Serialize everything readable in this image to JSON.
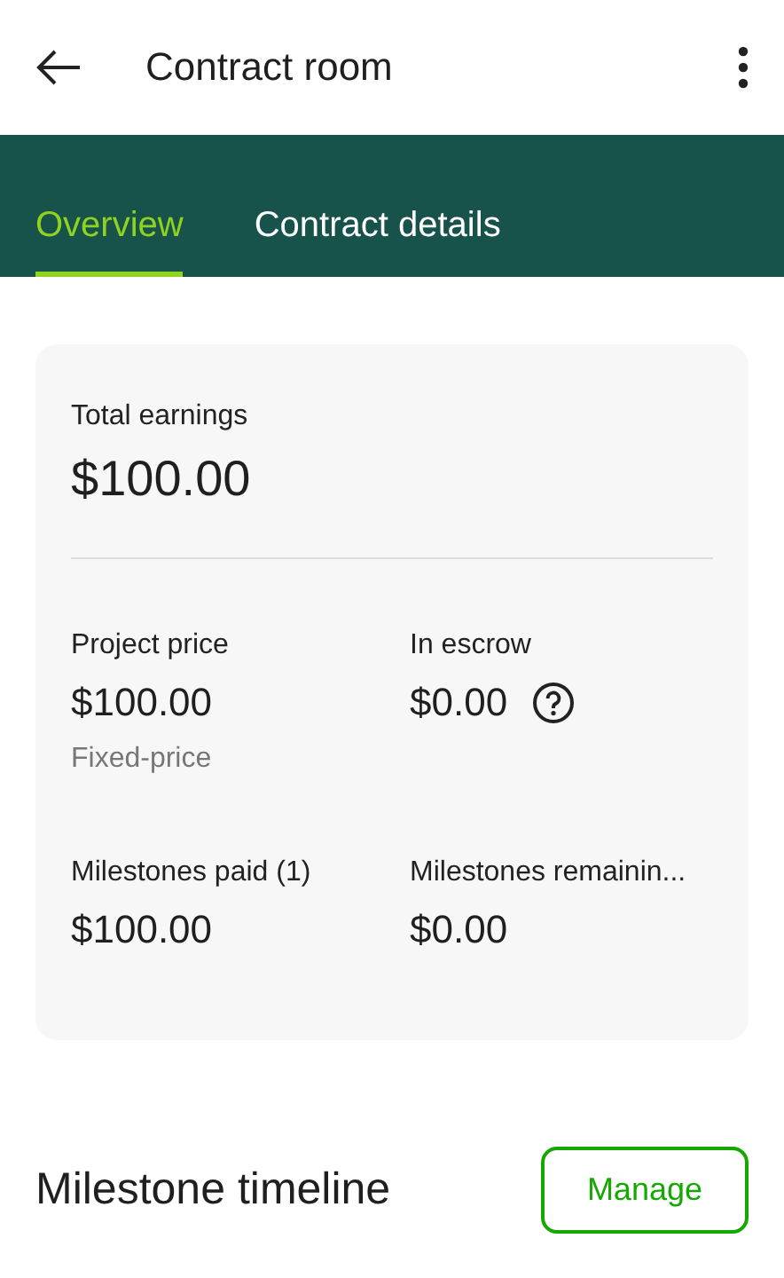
{
  "header": {
    "title": "Contract room"
  },
  "tabs": [
    {
      "label": "Overview",
      "selected": true
    },
    {
      "label": "Contract details",
      "selected": false
    }
  ],
  "summary": {
    "label": "Total earnings",
    "value": "$100.00"
  },
  "stats": [
    {
      "label": "Project price",
      "value": "$100.00",
      "note": "Fixed-price",
      "info_icon": false
    },
    {
      "label": "In escrow",
      "value": "$0.00",
      "info_icon": true
    },
    {
      "label": "Milestones paid (1)",
      "value": "$100.00",
      "info_icon": false
    },
    {
      "label": "Milestones remainin...",
      "value": "$0.00",
      "info_icon": false
    }
  ],
  "section": {
    "title": "Milestone timeline",
    "button": "Manage"
  }
}
